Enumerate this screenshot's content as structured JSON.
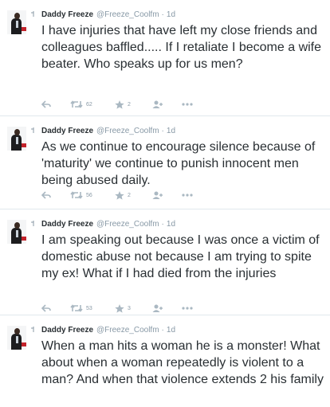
{
  "tweets": [
    {
      "name": "Daddy Freeze",
      "handle": "@Freeze_Coolfm",
      "dot": "·",
      "time": "1d",
      "text": "I have injuries that have left my close friends and colleagues baffled..... If I retaliate I become a wife beater. Who speaks up for us men?",
      "retweets": "62",
      "favorites": "2"
    },
    {
      "name": "Daddy Freeze",
      "handle": "@Freeze_Coolfm",
      "dot": "·",
      "time": "1d",
      "text": "As we continue to encourage silence because of 'maturity' we continue to punish innocent men being abused daily.",
      "retweets": "56",
      "favorites": "2"
    },
    {
      "name": "Daddy Freeze",
      "handle": "@Freeze_Coolfm",
      "dot": "·",
      "time": "1d",
      "text": "I am speaking out because I was once a victim of domestic abuse not because I am trying to spite my ex! What if I had died from the injuries",
      "retweets": "53",
      "favorites": "3"
    },
    {
      "name": "Daddy Freeze",
      "handle": "@Freeze_Coolfm",
      "dot": "·",
      "time": "1d",
      "text": "When a man hits a woman he is a monster! What about when a woman repeatedly is violent to a man? And when that violence extends 2 his family"
    }
  ],
  "icons": {
    "reply": "reply-icon",
    "retweet": "retweet-icon",
    "favorite": "star-icon",
    "follow": "follow-icon",
    "more": "more-icon"
  },
  "colors": {
    "text": "#292f33",
    "muted": "#8899a6",
    "icon": "#aab8c2",
    "divider": "#e1e8ed"
  }
}
